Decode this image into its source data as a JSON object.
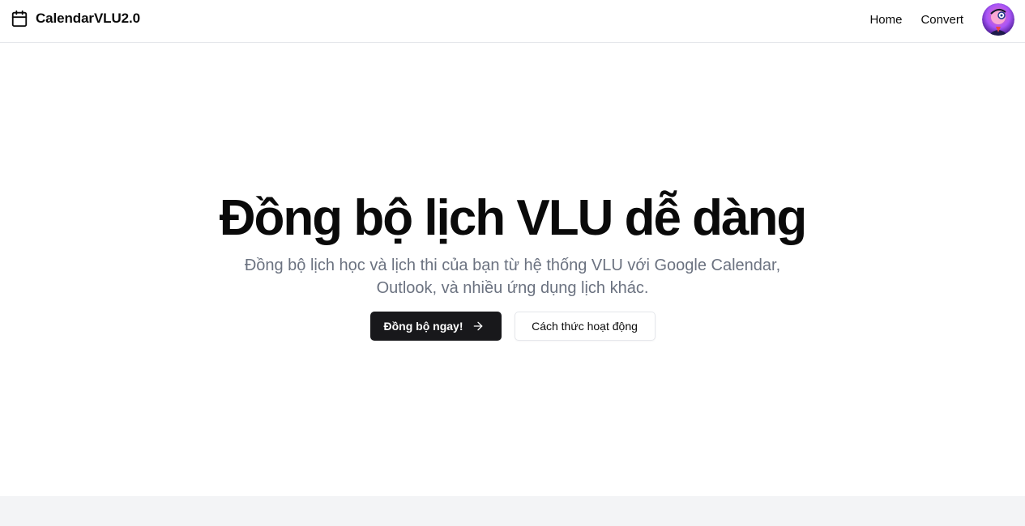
{
  "header": {
    "brand_name": "CalendarVLU2.0",
    "brand_icon": "calendar-icon",
    "nav": [
      {
        "label": "Home"
      },
      {
        "label": "Convert"
      }
    ],
    "avatar_icon": "user-avatar"
  },
  "hero": {
    "title": "Đồng bộ lịch VLU dễ dàng",
    "subtitle": "Đồng bộ lịch học và lịch thi của bạn từ hệ thống VLU với Google Calendar, Outlook, và nhiều ứng dụng lịch khác.",
    "primary_button": {
      "label": "Đồng bộ ngay!",
      "icon": "arrow-right-icon"
    },
    "secondary_button": {
      "label": "Cách thức hoạt động"
    }
  },
  "colors": {
    "primary": "#18181b",
    "muted_text": "#6b7280",
    "border": "#e5e7eb",
    "footer_bg": "#f3f4f6"
  }
}
